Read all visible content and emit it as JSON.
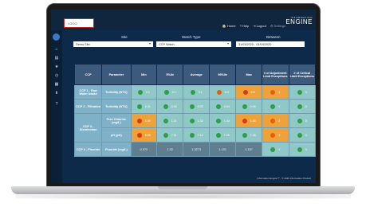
{
  "header": {
    "logo": "LOGO",
    "nav": [
      "Home",
      "Help",
      "Logout",
      "Settings"
    ],
    "brand_small": "INFORMATION",
    "brand_big": "ENGINE"
  },
  "sidebar": {
    "avatar": "",
    "icons": [
      "home-icon",
      "chart-icon",
      "list-icon",
      "clock-icon",
      "grid-icon",
      "download-icon",
      "help-icon"
    ]
  },
  "filters": {
    "site_label": "Site",
    "site_value": "Demo Site",
    "watch_label": "Watch Type",
    "watch_value": "CCP Watch",
    "between_label": "Between",
    "between_value": "31/03/2020 - 01/04/2020"
  },
  "table": {
    "headers": [
      "CCP",
      "Parameter",
      "Min",
      "5%ile",
      "Average",
      "95%ile",
      "Max",
      "# of Adjustment Limit Exceptions",
      "# of Critical Limit Exceptions"
    ],
    "rows": [
      {
        "ccp": "CCP 1 - Raw Water Intake",
        "param": "Turbidity (NTU)",
        "cells": [
          {
            "c": "g",
            "v": "0.1"
          },
          {
            "c": "g",
            "v": "0.1"
          },
          {
            "c": "g",
            "v": "0.1"
          },
          {
            "c": "o",
            "v": "0.3"
          },
          {
            "c": "r",
            "v": "0.5"
          }
        ],
        "adj": {
          "c": "o",
          "v": "1"
        },
        "crit": {
          "c": "g",
          "v": "0"
        }
      },
      {
        "ccp": "CCP 2 - Filtration",
        "param": "Turbidity (NTU)",
        "cells": [
          {
            "c": "g",
            "v": "0.01"
          },
          {
            "c": "g",
            "v": "0.02"
          },
          {
            "c": "g",
            "v": "0.03"
          },
          {
            "c": "g",
            "v": "0.04"
          },
          {
            "c": "g",
            "v": "0.06"
          }
        ],
        "adj": {
          "c": "g",
          "v": "0"
        },
        "crit": {
          "c": "g",
          "v": "0"
        }
      },
      {
        "ccp": "CCP 3 - Disinfection",
        "param": "Free Chlorine (mg/L)",
        "cells": [
          {
            "c": "r",
            "v": "1.00"
          },
          {
            "c": "g",
            "v": "1.21"
          },
          {
            "c": "g",
            "v": "1.32"
          },
          {
            "c": "g",
            "v": "1.44"
          },
          {
            "c": "r",
            "v": "1.55"
          }
        ],
        "adj": {
          "c": "o",
          "v": "2"
        },
        "crit": {
          "c": "g",
          "v": "0"
        }
      },
      {
        "ccp": "",
        "param": "pH (pH)",
        "cells": [
          {
            "c": "r",
            "v": "6.95"
          },
          {
            "c": "g",
            "v": "7.01"
          },
          {
            "c": "g",
            "v": "7.12"
          },
          {
            "c": "g",
            "v": "7.26"
          },
          {
            "c": "g",
            "v": "7.35"
          }
        ],
        "adj": {
          "c": "o",
          "v": "1"
        },
        "crit": {
          "c": "g",
          "v": "0"
        }
      },
      {
        "ccp": "CCP 4 - Fluoride",
        "param": "Fluoride (mg/L)",
        "cells": [
          {
            "c": "grey",
            "v": "0.970"
          },
          {
            "c": "grey",
            "v": "1.02"
          },
          {
            "c": "grey",
            "v": "1.0273"
          },
          {
            "c": "grey",
            "v": "1.151"
          },
          {
            "c": "grey",
            "v": "1.157"
          }
        ],
        "adj": {
          "c": "g",
          "v": "0"
        },
        "crit": {
          "c": "g",
          "v": "0"
        }
      }
    ]
  },
  "footer": "Information Engine™ · © 2020 Information Product"
}
